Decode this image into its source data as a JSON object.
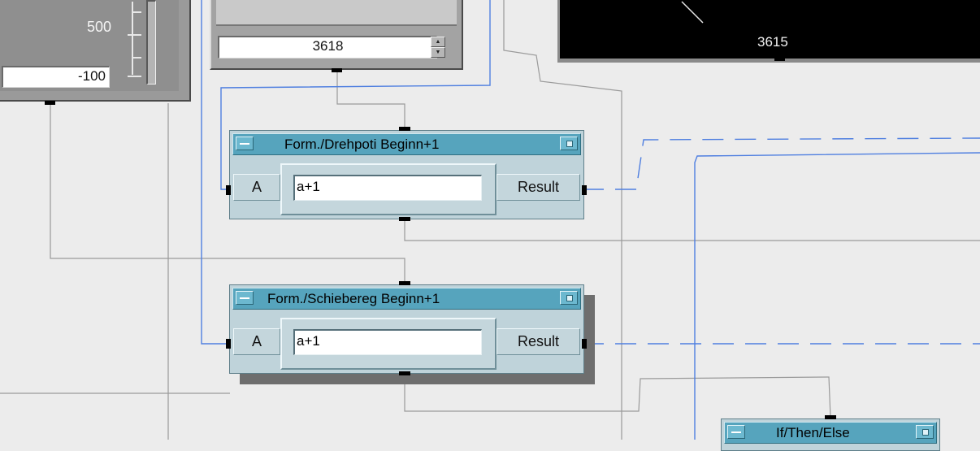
{
  "slider_panel": {
    "scale_label": "500",
    "value": "-100"
  },
  "knob_panel": {
    "value": "3618"
  },
  "display_panel": {
    "value": "3615"
  },
  "formula_top": {
    "title": "Form./Drehpoti Beginn+1",
    "input_label": "A",
    "expression": "a+1",
    "output_label": "Result"
  },
  "formula_bottom": {
    "title": "Form./Schiebereg Beginn+1",
    "input_label": "A",
    "expression": "a+1",
    "output_label": "Result"
  },
  "ifthen": {
    "title": "If/Then/Else"
  },
  "colors": {
    "canvas": "#ececec",
    "wire_data": "#4f7fe0",
    "wire_seq": "#8f8f8f",
    "object_body": "#bfd3da",
    "title_bar": "#56a4bd"
  }
}
